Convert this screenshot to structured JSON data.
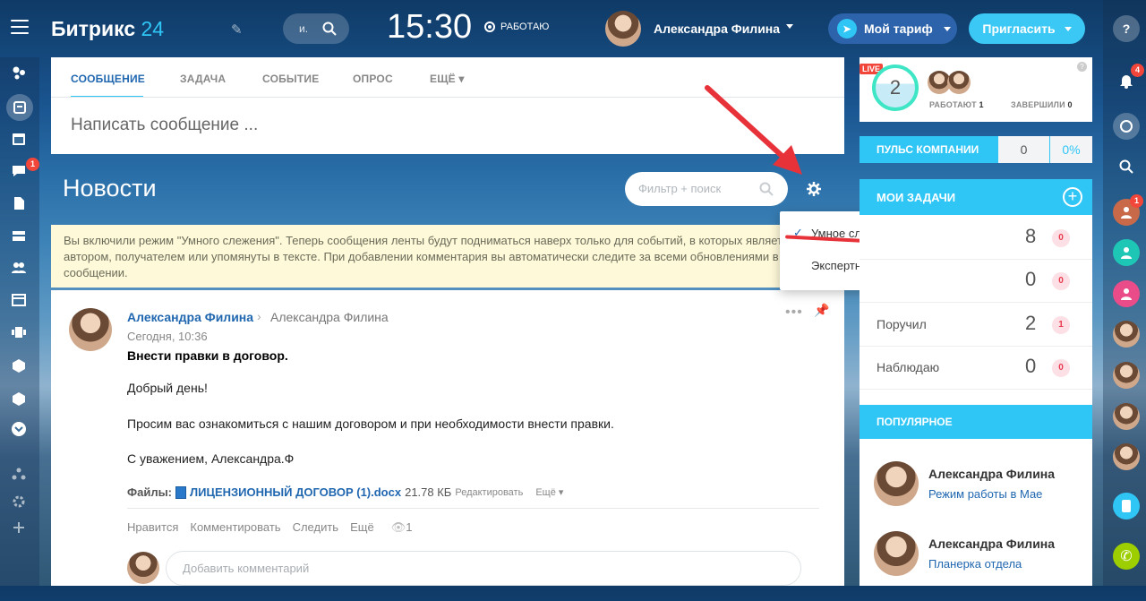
{
  "header": {
    "logo_main": "Битрикс",
    "logo_num": "24",
    "search_placeholder": "и.",
    "clock": "15:30",
    "status": "РАБОТАЮ",
    "user_name": "Александра Филина",
    "tariff": "Мой тариф",
    "invite": "Пригласить"
  },
  "sidebar": {
    "chat_badge": "1"
  },
  "composer": {
    "tabs": [
      "СООБЩЕНИЕ",
      "ЗАДАЧА",
      "СОБЫТИЕ",
      "ОПРОС",
      "ЕЩЁ"
    ],
    "placeholder": "Написать сообщение ..."
  },
  "feed": {
    "title": "Новости",
    "filter_placeholder": "Фильтр + поиск",
    "info": "Вы включили режим \"Умного слежения\". Теперь сообщения ленты будут подниматься наверх только для событий, в которых являетесь автором, получателем или упомянуты в тексте. При добавлении комментария вы автоматически следите за всеми обновлениями в сообщении."
  },
  "dropdown": {
    "items": [
      "Умное слежение",
      "Экспертный режим"
    ],
    "checked": "✓"
  },
  "post": {
    "author": "Александра Филина",
    "arrow": "›",
    "destination": "Александра Филина",
    "time": "Сегодня, 10:36",
    "title": "Внести правки в договор.",
    "p1": "Добрый день!",
    "p2": "Просим вас ознакомиться с нашим договором и при необходимости внести правки.",
    "p3": "С уважением, Александра.Ф",
    "files_label": "Файлы:",
    "file_name": "ЛИЦЕНЗИОННЫЙ ДОГОВОР (1).docx",
    "file_size": "21.78 КБ",
    "file_edit": "Редактировать",
    "file_more": "Ещё",
    "actions": [
      "Нравится",
      "Комментировать",
      "Следить",
      "Ещё"
    ],
    "views": "1",
    "comment_placeholder": "Добавить комментарий"
  },
  "live": {
    "tag": "LIVE",
    "count": "2",
    "working_label": "РАБОТАЮТ",
    "working": "1",
    "finished_label": "ЗАВЕРШИЛИ",
    "finished": "0",
    "help": "?"
  },
  "pulse": {
    "label": "ПУЛЬС КОМПАНИИ",
    "value": "0",
    "percent": "0%"
  },
  "tasks": {
    "title": "МОИ ЗАДАЧИ",
    "plus": "+",
    "rows": [
      {
        "label": "",
        "num": "8",
        "count": "0"
      },
      {
        "label": "",
        "num": "0",
        "count": "0"
      },
      {
        "label": "Поручил",
        "num": "2",
        "count": "1"
      },
      {
        "label": "Наблюдаю",
        "num": "0",
        "count": "0"
      }
    ]
  },
  "popular": {
    "title": "ПОПУЛЯРНОЕ",
    "items": [
      {
        "name": "Александра Филина",
        "sub": "Режим работы в Мае"
      },
      {
        "name": "Александра Филина",
        "sub": "Планерка отдела"
      }
    ]
  },
  "rightbar": {
    "bell_badge": "4",
    "group_badge": "1"
  },
  "colors": {
    "accent": "#2fc6f6",
    "link": "#2067b0",
    "alert": "#f2463a",
    "annotation": "#e8323a"
  }
}
